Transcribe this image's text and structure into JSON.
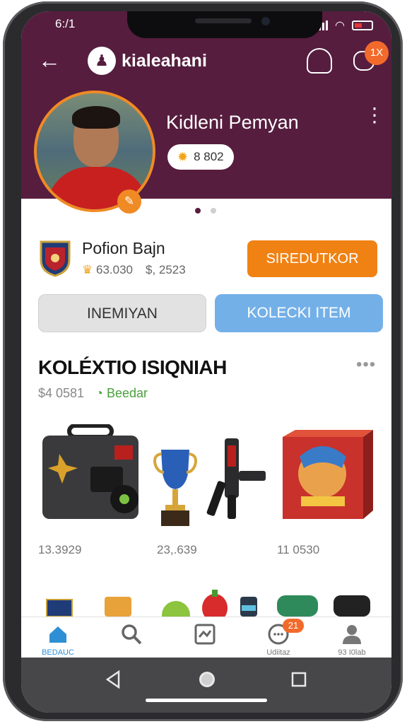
{
  "status_bar": {
    "time": "6:/1"
  },
  "app": {
    "name": "kialeahani"
  },
  "header": {
    "notification_count": "1X"
  },
  "profile": {
    "name": "Kidleni Pemyan",
    "points": "8 802"
  },
  "club": {
    "name": "Pofion Bajn",
    "stat_coins": "63.030",
    "stat_money": "$, 2523",
    "action_label": "SIREDUTKOR"
  },
  "tabs": [
    {
      "label": "INEMIYAN"
    },
    {
      "label": "KOLECKI ITEM"
    }
  ],
  "collection": {
    "title": "KOLÉXTIO ISIQNIAH",
    "more_label": "•••",
    "value": "$4 0581",
    "status": "Beedar",
    "items": [
      {
        "name": "kit-case",
        "price": "13.3929"
      },
      {
        "name": "trophy",
        "price": "23,.639"
      },
      {
        "name": "blaster",
        "price": ""
      },
      {
        "name": "art-box",
        "price": "11 0530"
      }
    ]
  },
  "bottom_nav": [
    {
      "label": "BEDAUC",
      "icon": "home-icon"
    },
    {
      "label": "",
      "icon": "search-icon"
    },
    {
      "label": "",
      "icon": "gallery-icon"
    },
    {
      "label": "Udiitaz",
      "icon": "clock-icon",
      "badge": "21"
    },
    {
      "label": "93 I0lab",
      "icon": "profile-icon"
    }
  ],
  "colors": {
    "header": "#561d3e",
    "accent_orange": "#f08213",
    "tab_blue": "#73b0e8",
    "active_blue": "#2f8fd4"
  }
}
